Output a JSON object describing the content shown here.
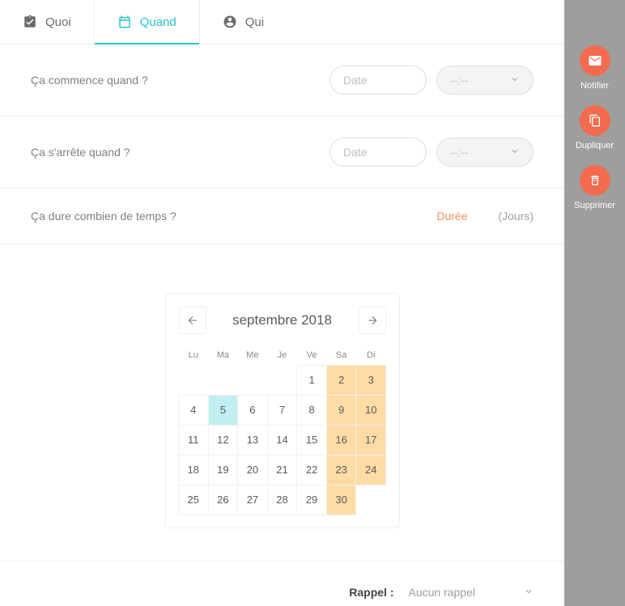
{
  "tabs": {
    "quoi": "Quoi",
    "quand": "Quand",
    "qui": "Qui"
  },
  "rows": {
    "start_label": "Ça commence quand ?",
    "end_label": "Ça s'arrête quand ?",
    "duration_label": "Ça dure combien de temps ?",
    "date_placeholder": "Date",
    "time_placeholder": "--:--",
    "duration_placeholder": "Durée",
    "unit": "(Jours)"
  },
  "calendar": {
    "title": "septembre 2018",
    "dow": [
      "Lu",
      "Ma",
      "Me",
      "Je",
      "Ve",
      "Sa",
      "Di"
    ],
    "first_dow": 5,
    "days_in_month": 30,
    "today": 5
  },
  "reminder": {
    "label": "Rappel :",
    "value": "Aucun rappel"
  },
  "actions": {
    "notify": "Notifier",
    "duplicate": "Dupliquer",
    "delete": "Supprimer"
  }
}
